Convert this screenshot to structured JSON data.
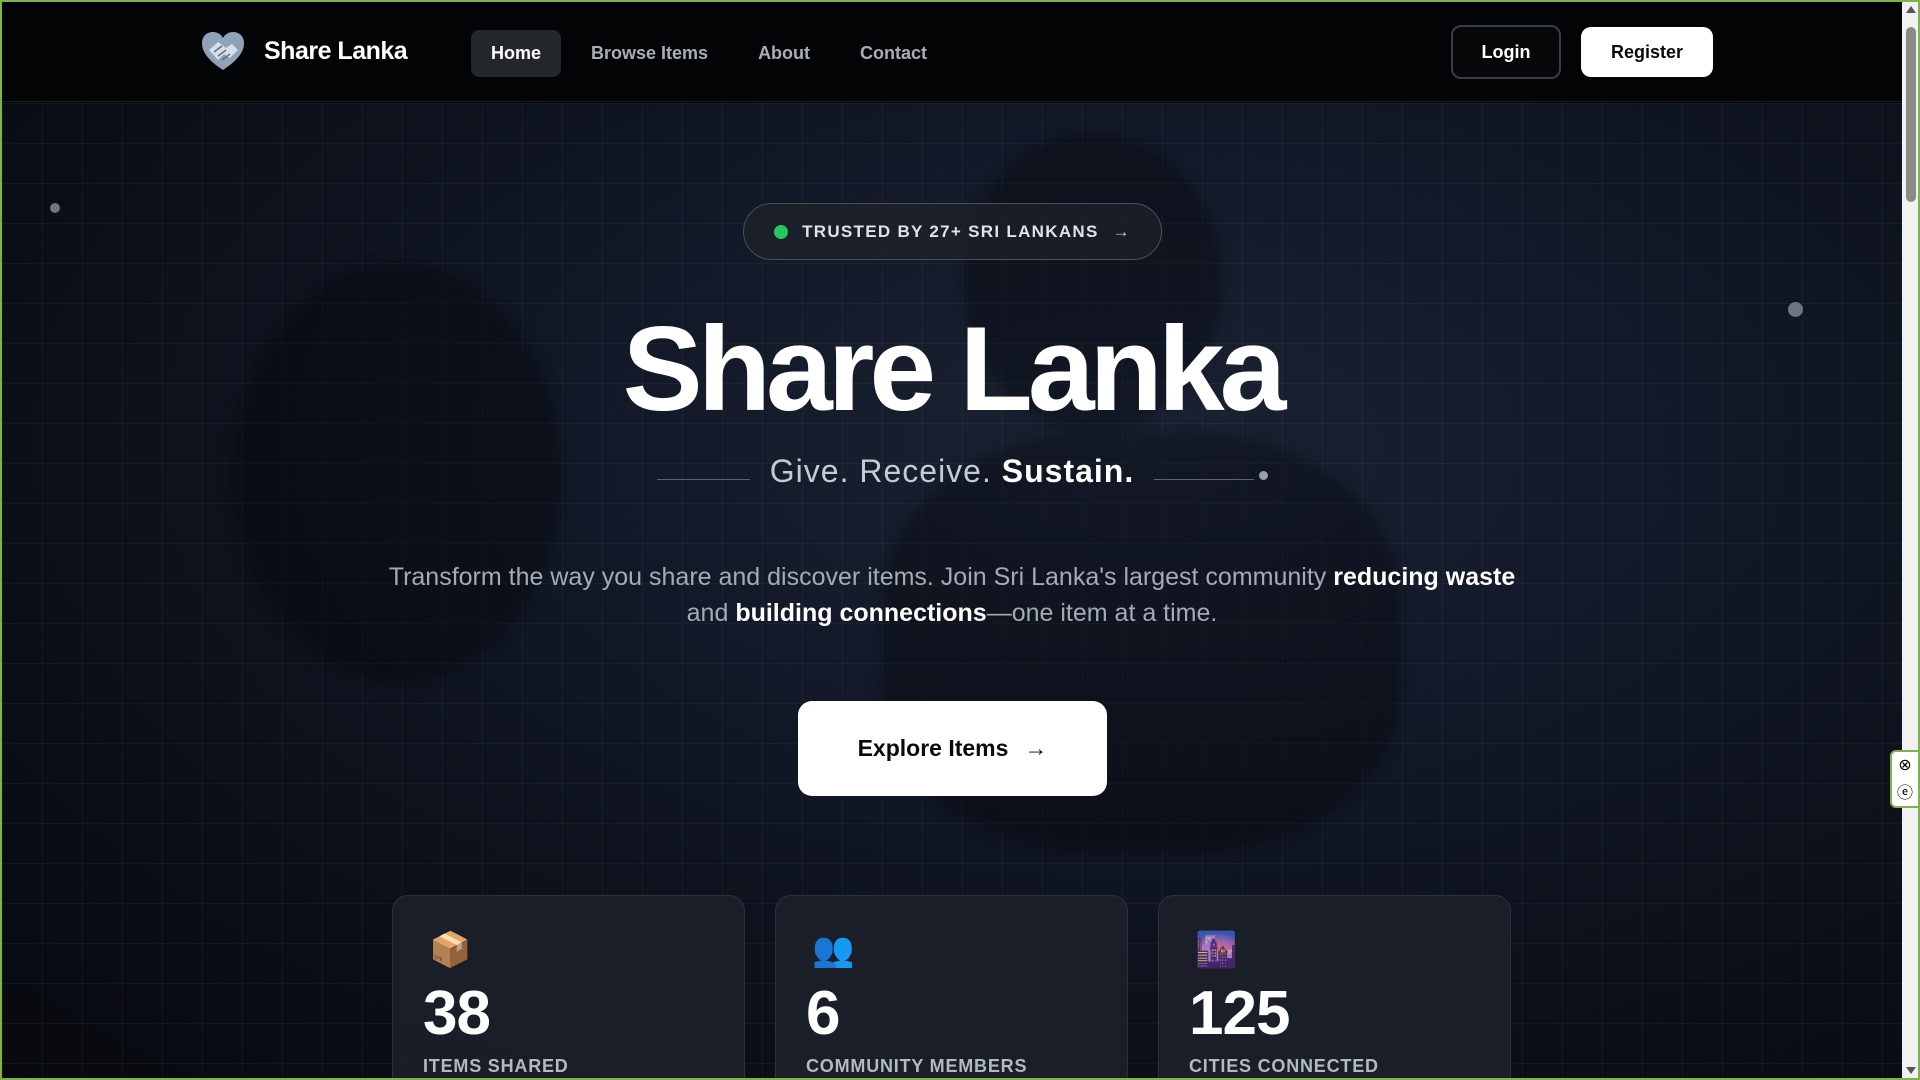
{
  "brand": {
    "name": "Share Lanka",
    "icon": "handshake-heart-icon"
  },
  "nav": {
    "links": [
      {
        "label": "Home",
        "active": true
      },
      {
        "label": "Browse Items",
        "active": false
      },
      {
        "label": "About",
        "active": false
      },
      {
        "label": "Contact",
        "active": false
      }
    ],
    "login_label": "Login",
    "register_label": "Register"
  },
  "hero": {
    "badge": "TRUSTED BY 27+ SRI LANKANS",
    "badge_arrow": "→",
    "title": "Share Lanka",
    "tagline_part1": "Give. Receive. ",
    "tagline_bold": "Sustain.",
    "desc_part1": "Transform the way you share and discover items. Join Sri Lanka's largest community ",
    "desc_bold1": "reducing waste",
    "desc_part2": " and ",
    "desc_bold2": "building connections",
    "desc_part3": "—one item at a time.",
    "cta_label": "Explore Items",
    "cta_arrow": "→"
  },
  "stats": [
    {
      "icon": "package-icon",
      "glyph": "📦",
      "value": "38",
      "label": "ITEMS SHARED"
    },
    {
      "icon": "people-icon",
      "glyph": "👥",
      "value": "6",
      "label": "COMMUNITY MEMBERS"
    },
    {
      "icon": "city-icon",
      "glyph": "🌆",
      "value": "125",
      "label": "CITIES CONNECTED"
    }
  ],
  "colors": {
    "accent_green": "#22c55e",
    "background": "#0b0f18",
    "button_light": "#ffffff"
  }
}
